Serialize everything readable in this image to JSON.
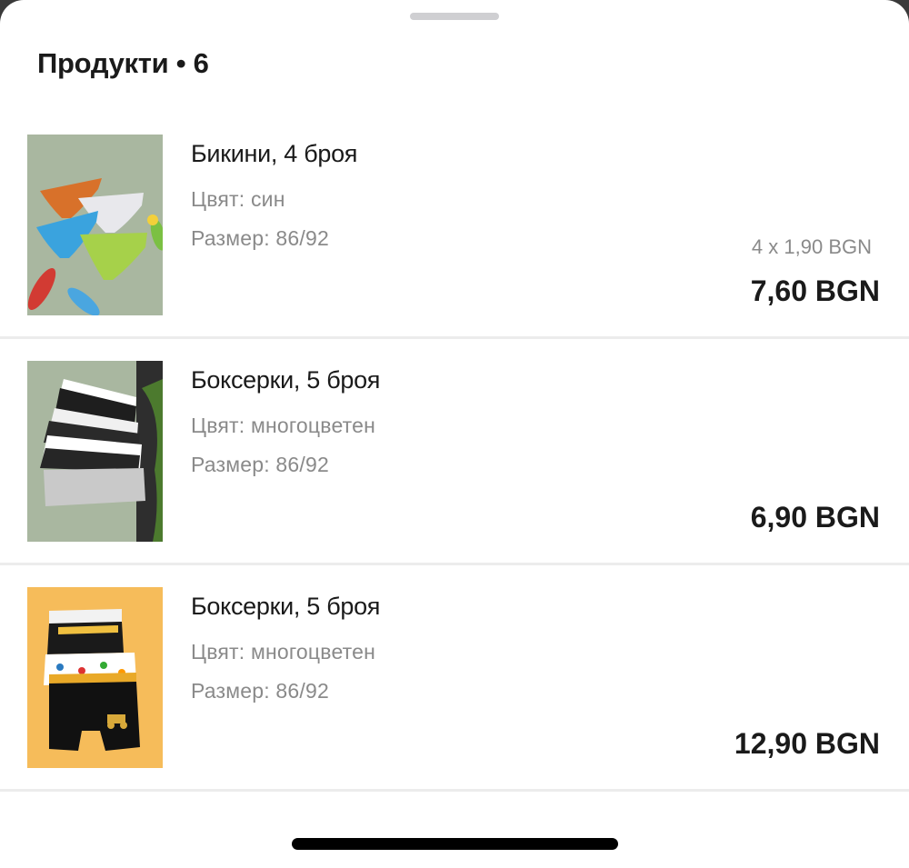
{
  "header": {
    "title": "Продукти • 6"
  },
  "products": [
    {
      "title": "Бикини, 4 броя",
      "color": "Цвят: син",
      "size": "Размер: 86/92",
      "unit_price": "4 x 1,90 BGN",
      "price": "7,60 BGN",
      "image": "bikini-pack-photo"
    },
    {
      "title": "Боксерки, 5 броя",
      "color": "Цвят: многоцветен",
      "size": "Размер: 86/92",
      "unit_price": "",
      "price": "6,90 BGN",
      "image": "boxers-gray-pack-photo"
    },
    {
      "title": "Боксерки, 5 броя",
      "color": "Цвят: многоцветен",
      "size": "Размер: 86/92",
      "unit_price": "",
      "price": "12,90 BGN",
      "image": "boxers-tractor-pack-photo"
    }
  ]
}
